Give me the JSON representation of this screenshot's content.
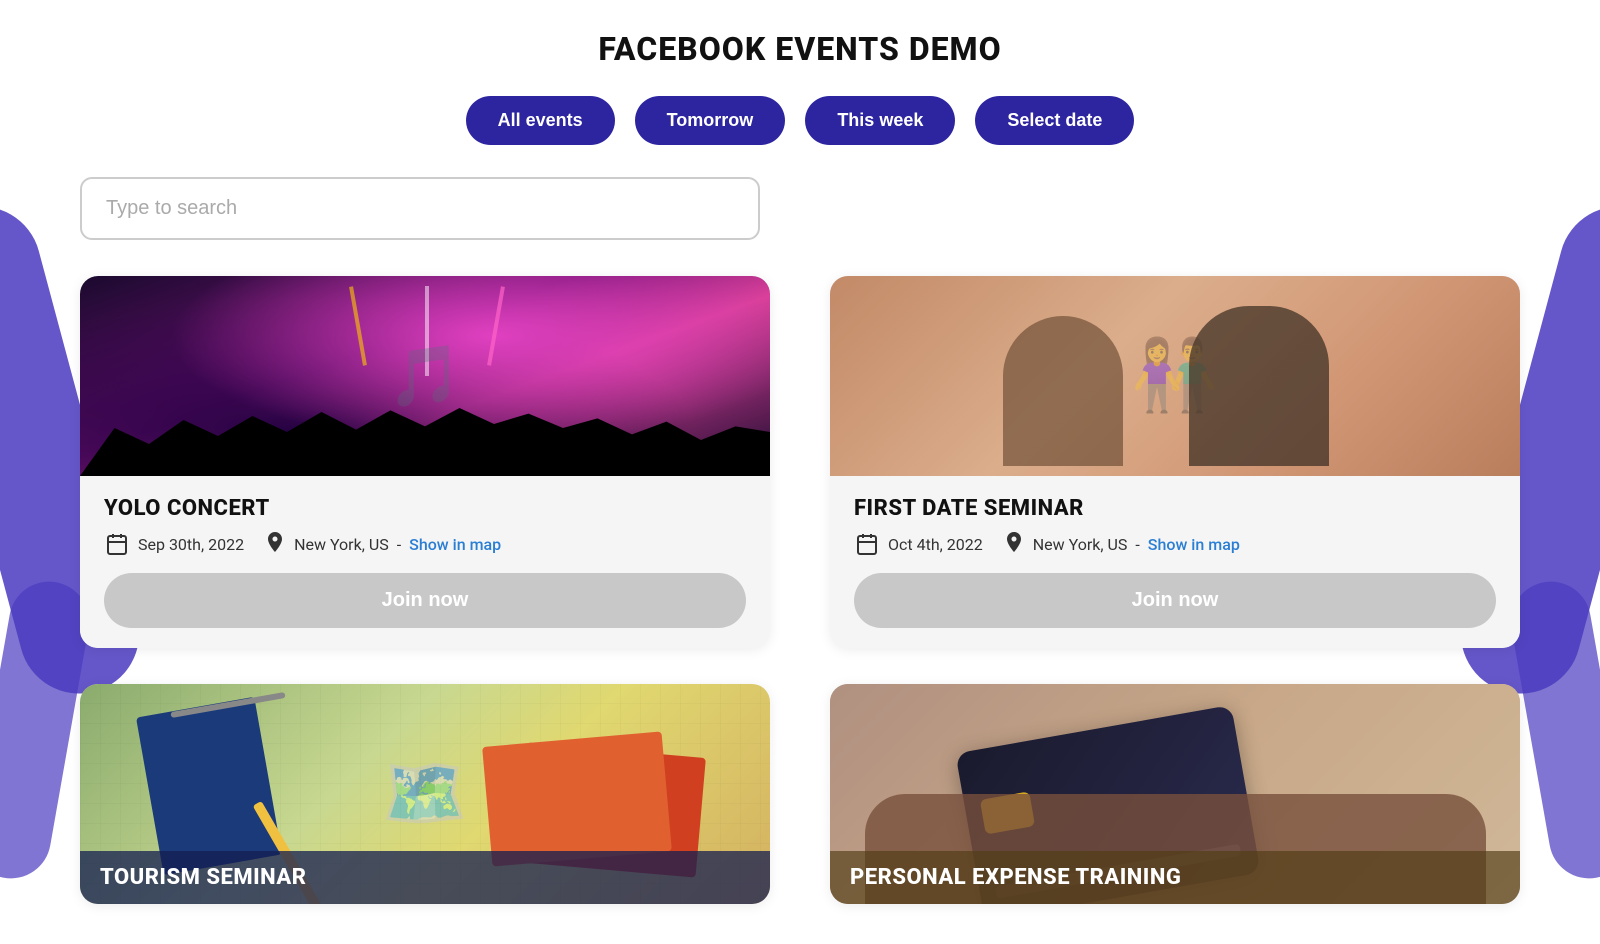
{
  "page": {
    "title": "FACEBOOK EVENTS DEMO"
  },
  "filters": {
    "all_events": "All events",
    "tomorrow": "Tomorrow",
    "this_week": "This week",
    "select_date": "Select date"
  },
  "search": {
    "placeholder": "Type to search"
  },
  "events": [
    {
      "id": "yolo-concert",
      "title": "YOLO CONCERT",
      "date": "Sep 30th, 2022",
      "location": "New York, US",
      "show_in_map": "Show in map",
      "join_label": "Join now",
      "image_type": "concert"
    },
    {
      "id": "first-date-seminar",
      "title": "FIRST DATE SEMINAR",
      "date": "Oct 4th, 2022",
      "location": "New York, US",
      "show_in_map": "Show in map",
      "join_label": "Join now",
      "image_type": "seminar"
    }
  ],
  "bottom_events": [
    {
      "id": "tourism-seminar",
      "title": "TOURISM SEMINAR",
      "image_type": "tourism"
    },
    {
      "id": "personal-expense-training",
      "title": "PERSONAL EXPENSE TRAINING",
      "image_type": "expense"
    }
  ],
  "icons": {
    "calendar": "📅",
    "location": "📍"
  }
}
